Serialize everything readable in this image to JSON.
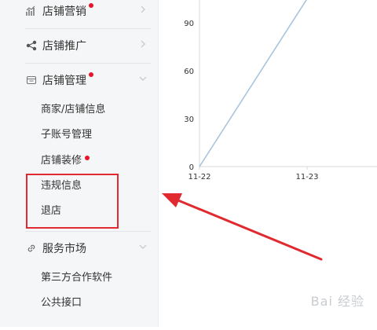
{
  "sidebar": {
    "groups": [
      {
        "label": "店铺营销",
        "badge": true,
        "icon": "chart-icon",
        "expanded": false
      },
      {
        "label": "店铺推广",
        "badge": false,
        "icon": "share-icon",
        "expanded": false
      },
      {
        "label": "店铺管理",
        "badge": true,
        "icon": "store-icon",
        "expanded": true
      },
      {
        "label": "服务市场",
        "badge": false,
        "icon": "link-icon",
        "expanded": true
      }
    ],
    "shop_items": [
      {
        "label": "商家/店铺信息",
        "badge": false
      },
      {
        "label": "子账号管理",
        "badge": false
      },
      {
        "label": "店铺装修",
        "badge": true
      },
      {
        "label": "违规信息",
        "badge": false
      },
      {
        "label": "退店",
        "badge": false
      }
    ],
    "service_items": [
      {
        "label": "第三方合作软件"
      },
      {
        "label": "公共接口"
      }
    ]
  },
  "chart_data": {
    "type": "line",
    "x": [
      "11-22",
      "11-23"
    ],
    "yticks": [
      0,
      30,
      60,
      90
    ],
    "ylim": [
      0,
      105
    ],
    "series": [
      {
        "values": [
          0,
          105
        ]
      }
    ],
    "line_color": "#a8c4de"
  },
  "annotation": {
    "color": "#e12a2f"
  },
  "watermark": {
    "text": "Bai 经验"
  }
}
